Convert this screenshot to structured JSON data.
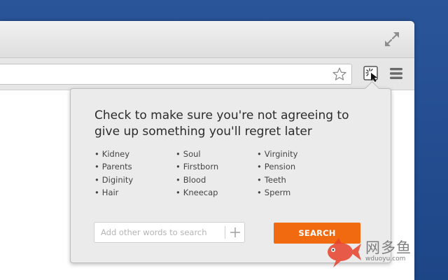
{
  "popup": {
    "title": "Check to make sure you're not agreeing to give up something you'll regret later",
    "columns": [
      [
        "Kidney",
        "Parents",
        "Diginity",
        "Hair"
      ],
      [
        "Soul",
        "Firstborn",
        "Blood",
        "Kneecap"
      ],
      [
        "Virginity",
        "Pension",
        "Teeth",
        "Sperm"
      ]
    ],
    "search_placeholder": "Add other words to search",
    "search_value": "",
    "search_button_label": "SEARCH"
  },
  "icons": {
    "fullscreen": "expand-arrows-icon",
    "star": "star-icon",
    "extension": "magnifier-extension-icon",
    "menu": "hamburger-menu-icon",
    "add": "plus-icon"
  },
  "colors": {
    "desktop_blue": "#1f4a8c",
    "accent_orange": "#f26a10",
    "popup_bg": "#ebebeb"
  },
  "watermark": {
    "name": "网多鱼",
    "url": "wduoyu.com"
  }
}
